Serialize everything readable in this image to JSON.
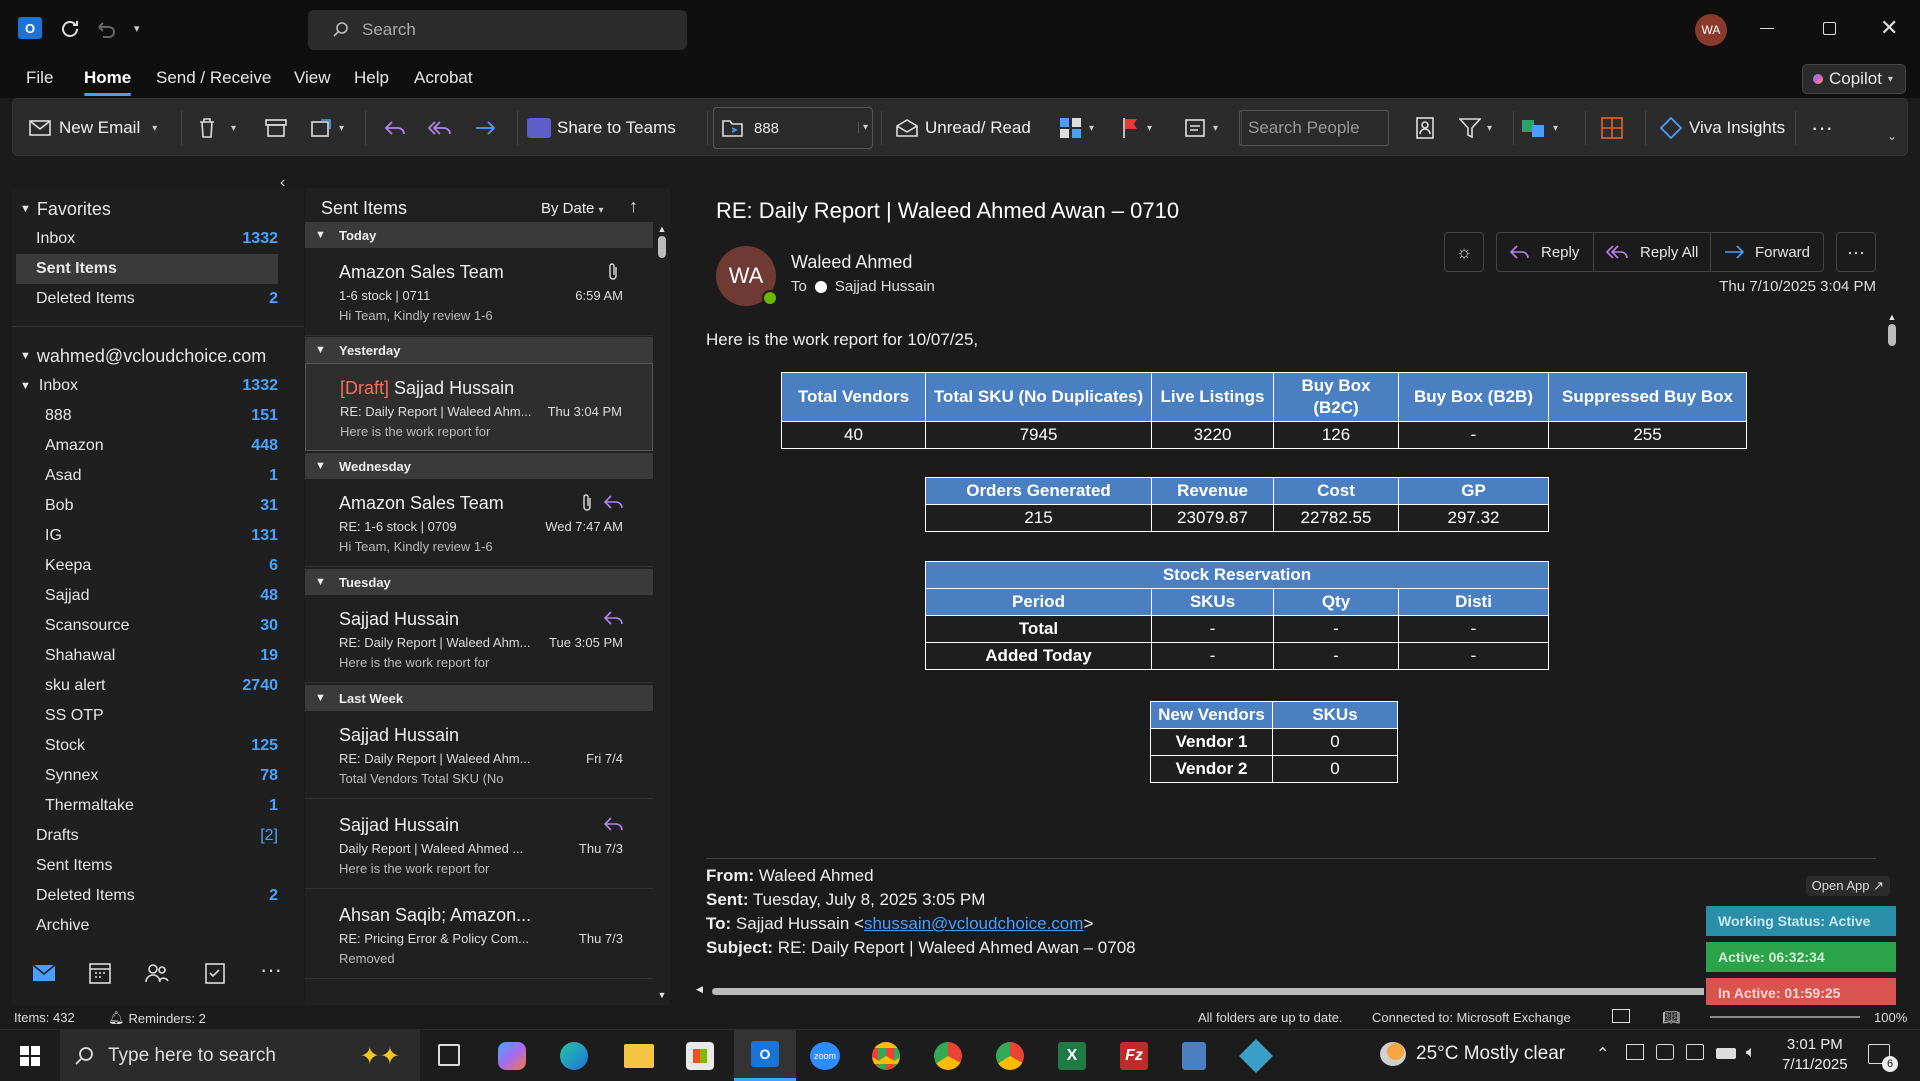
{
  "titlebar": {
    "search_placeholder": "Search",
    "avatar_initials": "WA",
    "copilot": "Copilot"
  },
  "menu": {
    "file": "File",
    "home": "Home",
    "send_receive": "Send / Receive",
    "view": "View",
    "help": "Help",
    "acrobat": "Acrobat"
  },
  "ribbon": {
    "new_email": "New Email",
    "share_teams": "Share to Teams",
    "move_folder": "888",
    "unread_read": "Unread/ Read",
    "search_people_placeholder": "Search People",
    "viva": "Viva Insights"
  },
  "folders": {
    "favorites_label": "Favorites",
    "favorites": [
      {
        "name": "Inbox",
        "count": "1332"
      },
      {
        "name": "Sent Items",
        "count": ""
      },
      {
        "name": "Deleted Items",
        "count": "2"
      }
    ],
    "account": "wahmed@vcloudchoice.com",
    "inbox": {
      "name": "Inbox",
      "count": "1332"
    },
    "subfolders": [
      {
        "name": "888",
        "count": "151"
      },
      {
        "name": "Amazon",
        "count": "448"
      },
      {
        "name": "Asad",
        "count": "1"
      },
      {
        "name": "Bob",
        "count": "31"
      },
      {
        "name": "IG",
        "count": "131"
      },
      {
        "name": "Keepa",
        "count": "6"
      },
      {
        "name": "Sajjad",
        "count": "48"
      },
      {
        "name": "Scansource",
        "count": "30"
      },
      {
        "name": "Shahawal",
        "count": "19"
      },
      {
        "name": "sku alert",
        "count": "2740"
      },
      {
        "name": "SS OTP",
        "count": ""
      },
      {
        "name": "Stock",
        "count": "125"
      },
      {
        "name": "Synnex",
        "count": "78"
      },
      {
        "name": "Thermaltake",
        "count": "1"
      }
    ],
    "others": [
      {
        "name": "Drafts",
        "count": "[2]"
      },
      {
        "name": "Sent Items",
        "count": ""
      },
      {
        "name": "Deleted Items",
        "count": "2"
      },
      {
        "name": "Archive",
        "count": ""
      }
    ]
  },
  "list": {
    "title": "Sent Items",
    "sort": "By Date",
    "groups": {
      "today": "Today",
      "yesterday": "Yesterday",
      "wednesday": "Wednesday",
      "tuesday": "Tuesday",
      "last_week": "Last Week"
    },
    "messages": [
      {
        "from": "Amazon Sales Team",
        "subject": "1-6 stock | 0711",
        "preview": "Hi Team,  Kindly review 1-6",
        "time": "6:59 AM"
      },
      {
        "draft": "[Draft]",
        "from": "Sajjad Hussain",
        "subject": "RE: Daily Report | Waleed Ahm...",
        "preview": "Here is the work report for",
        "time": "Thu 3:04 PM"
      },
      {
        "from": "Amazon Sales Team",
        "subject": "RE: 1-6 stock | 0709",
        "preview": "Hi Team,  Kindly review 1-6",
        "time": "Wed 7:47 AM"
      },
      {
        "from": "Sajjad Hussain",
        "subject": "RE: Daily Report | Waleed Ahm...",
        "preview": "Here is the work report for",
        "time": "Tue 3:05 PM"
      },
      {
        "from": "Sajjad Hussain",
        "subject": "RE: Daily Report | Waleed Ahm...",
        "preview": "Total Vendors  Total SKU (No",
        "time": "Fri 7/4"
      },
      {
        "from": "Sajjad Hussain",
        "subject": "Daily Report | Waleed Ahmed ...",
        "preview": "Here is the work report for",
        "time": "Thu 7/3"
      },
      {
        "from": "Ahsan Saqib; Amazon...",
        "subject": "RE: Pricing Error & Policy Com...",
        "preview": "Removed",
        "time": "Thu 7/3"
      }
    ]
  },
  "reading": {
    "subject": "RE: Daily Report | Waleed Ahmed Awan – 0710",
    "sender_initials": "WA",
    "sender": "Waleed Ahmed",
    "to_label": "To",
    "to": "Sajjad Hussain",
    "reply": "Reply",
    "reply_all": "Reply All",
    "forward": "Forward",
    "date": "Thu 7/10/2025 3:04 PM",
    "intro": "Here is the work report for 10/07/25,",
    "table1": {
      "headers": [
        "Total Vendors",
        "Total SKU (No Duplicates)",
        "Live Listings",
        "Buy Box (B2C)",
        "Buy Box (B2B)",
        "Suppressed Buy Box"
      ],
      "row": [
        "40",
        "7945",
        "3220",
        "126",
        "-",
        "255"
      ]
    },
    "table2": {
      "headers": [
        "Orders Generated",
        "Revenue",
        "Cost",
        "GP"
      ],
      "row": [
        "215",
        "23079.87",
        "22782.55",
        "297.32"
      ]
    },
    "table3": {
      "title": "Stock Reservation",
      "headers": [
        "Period",
        "SKUs",
        "Qty",
        "Disti"
      ],
      "rows": [
        [
          "Total",
          "-",
          "-",
          "-"
        ],
        [
          "Added Today",
          "-",
          "-",
          "-"
        ]
      ]
    },
    "table4": {
      "headers": [
        "New Vendors",
        "SKUs"
      ],
      "rows": [
        [
          "Vendor 1",
          "0"
        ],
        [
          "Vendor 2",
          "0"
        ]
      ]
    },
    "quoted": {
      "from_label": "From:",
      "from": " Waleed Ahmed",
      "sent_label": "Sent:",
      "sent": " Tuesday, July 8, 2025 3:05 PM",
      "to_label": "To:",
      "to_name": " Sajjad Hussain <",
      "to_email": "shussain@vcloudchoice.com",
      "to_close": ">",
      "subject_label": "Subject:",
      "subject": " RE: Daily Report | Waleed Ahmed Awan – 0708"
    }
  },
  "widget": {
    "open_app": "Open App ↗",
    "working": "Working Status: Active",
    "active": "Active: 06:32:34",
    "inactive": "In Active: 01:59:25"
  },
  "status": {
    "items": "Items: 432",
    "reminders": "Reminders: 2",
    "sync": "All folders are up to date.",
    "connected": "Connected to: Microsoft Exchange",
    "zoom": "100%"
  },
  "taskbar": {
    "search_placeholder": "Type here to search",
    "weather": "25°C  Mostly clear",
    "time": "3:01 PM",
    "date": "7/11/2025",
    "notif_count": "6"
  },
  "colors": {
    "accent": "#4a9eff",
    "count": "#4aa3ff",
    "table_header": "#4a7fc1",
    "draft": "#ff6b5a"
  }
}
